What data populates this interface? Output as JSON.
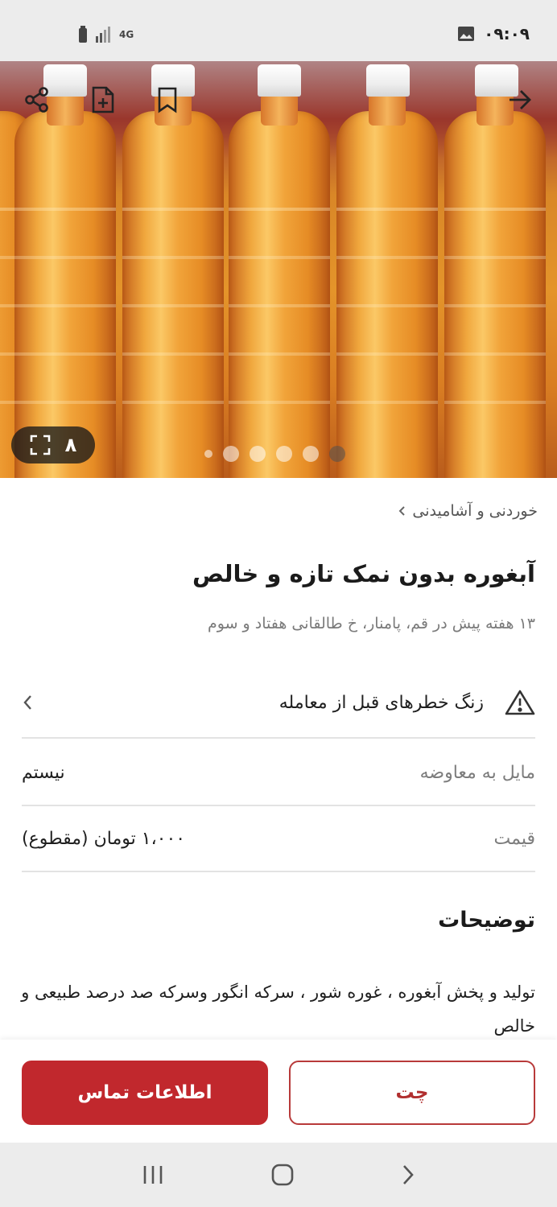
{
  "status_bar": {
    "time": "۰۹:۰۹",
    "network": "4G"
  },
  "hero": {
    "photo_count": "۸",
    "icons": [
      "share-icon",
      "add-note-icon",
      "bookmark-icon",
      "back-arrow-icon",
      "fullscreen-icon"
    ],
    "carousel_dots": 6
  },
  "ad": {
    "breadcrumb": "خوردنی و آشامیدنی",
    "title": "آبغوره بدون نمک تازه و خالص",
    "subtitle": "۱۳ هفته پیش در قم، پامنار، خ طالقانی هفتاد و سوم",
    "warning": "زنگ خطرهای قبل از معامله",
    "rows": [
      {
        "label": "مایل به معاوضه",
        "value": "نیستم"
      },
      {
        "label": "قیمت",
        "value": "۱،۰۰۰ تومان (مقطوع)"
      }
    ],
    "description_title": "توضیحات",
    "description": "تولید و پخش آبغوره ، غوره شور ، سرکه انگور وسرکه صد درصد طبیعی و خالص"
  },
  "actions": {
    "chat": "چت",
    "contact": "اطلاعات تماس"
  },
  "colors": {
    "brand": "#c1282d",
    "divider": "#e3e3e3",
    "muted_text": "#7d7d7d"
  }
}
